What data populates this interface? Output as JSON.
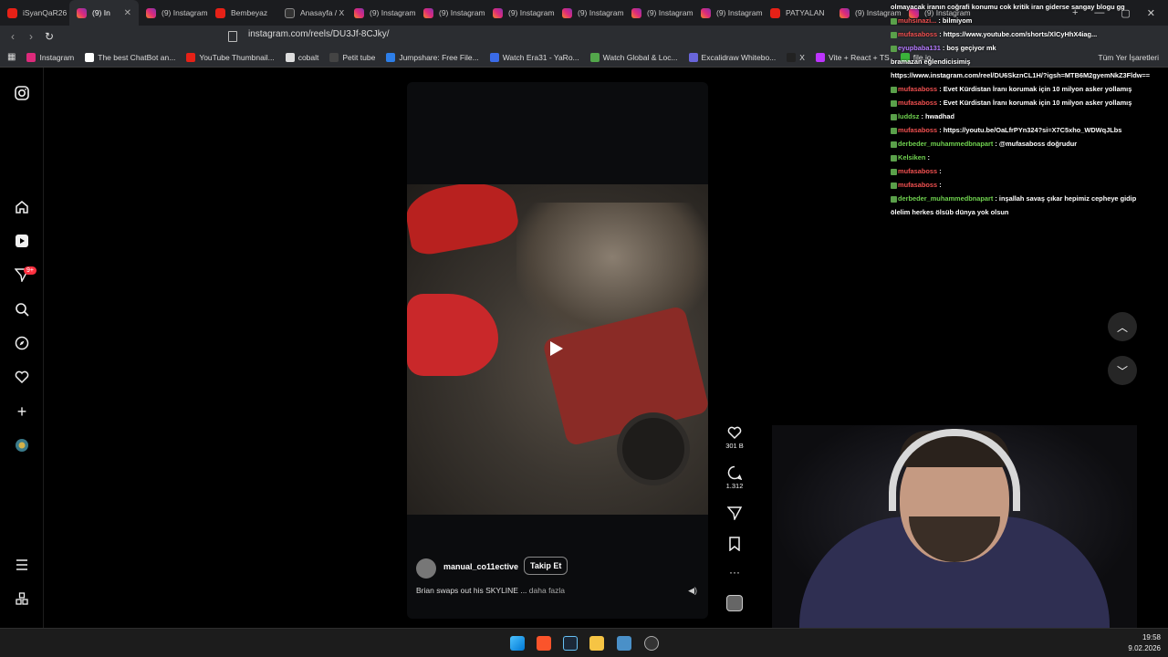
{
  "browser": {
    "tabs": [
      {
        "label": "iSyanQaR26",
        "kind": "yt"
      },
      {
        "label": "(9) In",
        "kind": "ig",
        "active": true
      },
      {
        "label": "(9) Instagram",
        "kind": "ig"
      },
      {
        "label": "Bembeyaz",
        "kind": "yt"
      },
      {
        "label": "Anasayfa / X",
        "kind": "x"
      },
      {
        "label": "(9) Instagram",
        "kind": "ig"
      },
      {
        "label": "(9) Instagram",
        "kind": "ig"
      },
      {
        "label": "(9) Instagram",
        "kind": "ig"
      },
      {
        "label": "(9) Instagram",
        "kind": "ig"
      },
      {
        "label": "(9) Instagram",
        "kind": "ig"
      },
      {
        "label": "(9) Instagram",
        "kind": "ig"
      },
      {
        "label": "PATYALAN",
        "kind": "yt"
      },
      {
        "label": "(9) Instagram",
        "kind": "ig"
      },
      {
        "label": "(9) Instagram",
        "kind": "ig"
      }
    ],
    "url": "instagram.com/reels/DU3Jf-8CJky/",
    "bookmarks": [
      {
        "label": "Instagram",
        "color": "#dd2a7b"
      },
      {
        "label": "The best ChatBot an...",
        "color": "#ffffff"
      },
      {
        "label": "YouTube Thumbnail...",
        "color": "#e62117"
      },
      {
        "label": "cobalt",
        "color": "#dddddd"
      },
      {
        "label": "Petit tube",
        "color": "#444444"
      },
      {
        "label": "Jumpshare: Free File...",
        "color": "#2d7ee8"
      },
      {
        "label": "Watch Era31 - YaRo...",
        "color": "#3a6be8"
      },
      {
        "label": "Watch Global & Loc...",
        "color": "#53a74b"
      },
      {
        "label": "Excalidraw Whitebo...",
        "color": "#6965db"
      },
      {
        "label": "X",
        "color": "#222222"
      },
      {
        "label": "Vite + React + TS",
        "color": "#bd34fe"
      },
      {
        "label": "file.io",
        "color": "#3bb33b"
      }
    ],
    "all_bookmarks": "Tüm Yer İşaretleri"
  },
  "reel": {
    "username": "manual_co11ective",
    "follow_label": "Takip Et",
    "caption": "Brian swaps out his SKYLINE ...",
    "caption_more": "daha fazla",
    "likes": "301 B",
    "comments": "1.312"
  },
  "chat": [
    {
      "user": "",
      "text": "olmayacak iranın coğrafi konumu cok kritik iran giderse sangay blogu gg",
      "color": "white"
    },
    {
      "user": "muhsinazi...",
      "text": ": bilmiyom",
      "color": "red"
    },
    {
      "user": "mufasaboss",
      "text": ": https://www.youtube.com/shorts/XlCyHhX4iag...",
      "color": "red"
    },
    {
      "user": "eyupbaba131",
      "text": ": boş geçiyor mk",
      "color": "purple"
    },
    {
      "user": "",
      "text": "bramazan eğlendicisimiş",
      "color": "white"
    },
    {
      "user": "",
      "text": "https://www.instagram.com/reel/DU6SkznCL1H/?igsh=MTB6M2gyemNkZ3Fldw==",
      "color": "white"
    },
    {
      "user": "mufasaboss",
      "text": ": Evet Kürdistan İranı korumak için 10 milyon asker yollamış",
      "color": "red"
    },
    {
      "user": "mufasaboss",
      "text": ": Evet Kürdistan İranı korumak için 10 milyon asker yollamış",
      "color": "red"
    },
    {
      "user": "luddsz",
      "text": ": hwadhad",
      "color": "green"
    },
    {
      "user": "mufasaboss",
      "text": ": https://youtu.be/OaLfrPYn324?si=X7C5xho_WDWqJLbs",
      "color": "red"
    },
    {
      "user": "derbeder_muhammedbnapart",
      "text": ": @mufasaboss doğrudur",
      "color": "green"
    },
    {
      "user": "Kelsiken",
      "text": ":",
      "color": "white"
    },
    {
      "user": "mufasaboss",
      "text": ":",
      "color": "red"
    },
    {
      "user": "mufasaboss",
      "text": ":",
      "color": "red"
    },
    {
      "user": "derbeder_muhammedbnapart",
      "text": ": inşallah savaş çıkar hepimiz cepheye gidip",
      "color": "green"
    },
    {
      "user": "",
      "text": "ölelim herkes ölsüb dünya yok olsun",
      "color": "white"
    }
  ],
  "clock": {
    "time": "19:58",
    "date": "9.02.2026"
  },
  "colors": {
    "accent": "#0095f6",
    "badge": "#ff3040"
  }
}
